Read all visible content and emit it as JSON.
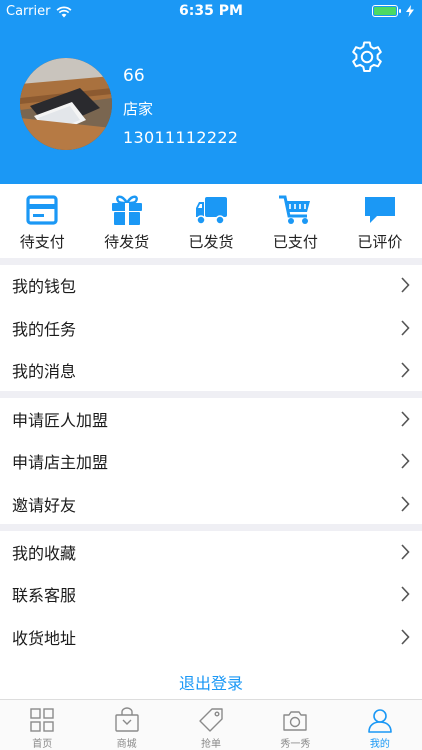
{
  "colors": {
    "primary": "#1b98f5",
    "inactive": "#8a8a8a",
    "divider": "#efeff4"
  },
  "status_bar": {
    "carrier": "Carrier",
    "time": "6:35 PM"
  },
  "profile": {
    "name": "66",
    "role": "店家",
    "phone": "13011112222"
  },
  "orders": [
    {
      "label": "待支付",
      "icon": "card-icon"
    },
    {
      "label": "待发货",
      "icon": "gift-icon"
    },
    {
      "label": "已发货",
      "icon": "truck-icon"
    },
    {
      "label": "已支付",
      "icon": "cart-icon"
    },
    {
      "label": "已评价",
      "icon": "comment-icon"
    }
  ],
  "menu": {
    "group1": [
      "我的钱包",
      "我的任务",
      "我的消息"
    ],
    "group2": [
      "申请匠人加盟",
      "申请店主加盟",
      "邀请好友"
    ],
    "group3": [
      "我的收藏",
      "联系客服",
      "收货地址"
    ]
  },
  "logout_label": "退出登录",
  "tabbar": [
    {
      "label": "首页",
      "icon": "grid-icon",
      "active": false
    },
    {
      "label": "商城",
      "icon": "bag-icon",
      "active": false
    },
    {
      "label": "抢单",
      "icon": "tag-icon",
      "active": false
    },
    {
      "label": "秀一秀",
      "icon": "camera-icon",
      "active": false
    },
    {
      "label": "我的",
      "icon": "user-icon",
      "active": true
    }
  ]
}
